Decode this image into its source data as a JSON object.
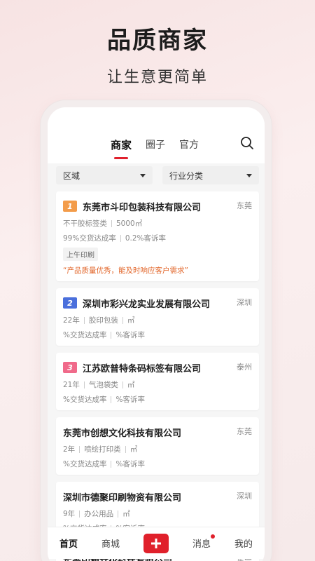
{
  "hero": {
    "title": "品质商家",
    "subtitle": "让生意更简单"
  },
  "tabs": [
    {
      "label": "商家",
      "active": true
    },
    {
      "label": "圈子",
      "active": false
    },
    {
      "label": "官方",
      "active": false
    }
  ],
  "filters": {
    "region": "区域",
    "industry": "行业分类"
  },
  "merchants": [
    {
      "rank": "1",
      "rank_color": "#f39c4a",
      "name": "东莞市斗印包装科技有限公司",
      "city": "东莞",
      "meta1": [
        "不干胶标签类",
        "5000㎡"
      ],
      "meta2": [
        "99%交货达成率",
        "0.2%客诉率"
      ],
      "tag": "上午印刷",
      "quote": "“产品质量优秀，能及时响应客户需求”"
    },
    {
      "rank": "2",
      "rank_color": "#4a6fdc",
      "name": "深圳市彩兴龙实业发展有限公司",
      "city": "深圳",
      "meta1": [
        "22年",
        "胶印包装",
        "㎡"
      ],
      "meta2": [
        "%交货达成率",
        "%客诉率"
      ]
    },
    {
      "rank": "3",
      "rank_color": "#f06a8a",
      "name": "江苏欧普特条码标签有限公司",
      "city": "泰州",
      "meta1": [
        "21年",
        "气泡袋类",
        "㎡"
      ],
      "meta2": [
        "%交货达成率",
        "%客诉率"
      ]
    },
    {
      "name": "东莞市创想文化科技有限公司",
      "city": "东莞",
      "meta1": [
        "2年",
        "喷绘打印类",
        "㎡"
      ],
      "meta2": [
        "%交货达成率",
        "%客诉率"
      ]
    },
    {
      "name": "深圳市德聚印刷物资有限公司",
      "city": "深圳",
      "meta1": [
        "9年",
        "办公用品",
        "㎡"
      ],
      "meta2": [
        "%交货达成率",
        "%客诉率"
      ]
    },
    {
      "name": "东莞印想文化科技有限公司",
      "city": "东莞"
    }
  ],
  "bottom_nav": {
    "home": "首页",
    "mall": "商城",
    "messages": "消息",
    "mine": "我的"
  },
  "colors": {
    "accent": "#e0202b",
    "quote": "#e2662a"
  }
}
